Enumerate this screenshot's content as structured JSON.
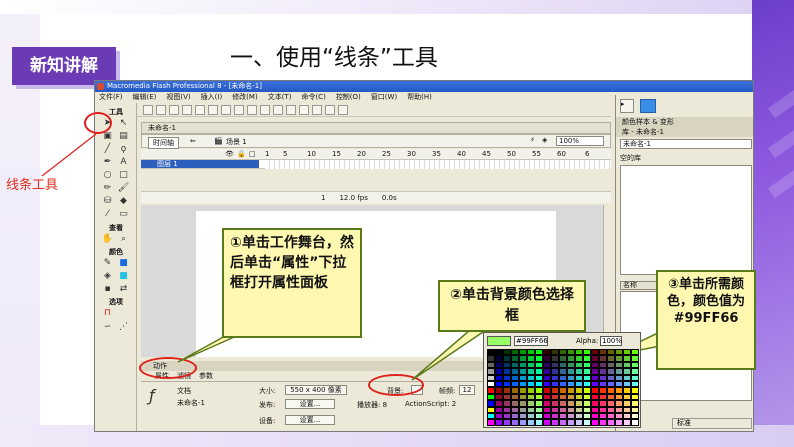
{
  "slide": {
    "badge": "新知讲解",
    "title": "一、使用“线条”工具",
    "side_label": "线条工具"
  },
  "window": {
    "title": "Macromedia Flash Professional 8 - [未命名-1]",
    "menus": [
      "文件(F)",
      "编辑(E)",
      "视图(V)",
      "插入(I)",
      "修改(M)",
      "文本(T)",
      "命令(C)",
      "控制(O)",
      "窗口(W)",
      "帮助(H)"
    ]
  },
  "toolbox": {
    "tools_label": "工具",
    "view_label": "查看",
    "colors_label": "颜色",
    "options_label": "选项"
  },
  "document": {
    "tab": "未命名-1",
    "timeline_button": "时间轴",
    "scene": "场景 1",
    "zoom": "100%",
    "layer": "图层 1",
    "frame_numbers": [
      "1",
      "5",
      "10",
      "15",
      "20",
      "25",
      "30",
      "35",
      "40",
      "45",
      "50",
      "55",
      "60",
      "6"
    ],
    "status": {
      "frame": "1",
      "fps": "12.0 fps",
      "time": "0.0s"
    }
  },
  "right_panel": {
    "top_tab": "颜色样本 & 变形",
    "library_tab": "库 - 未命名-1",
    "library_doc": "未命名-1",
    "library_empty": "空的库",
    "col_name": "名称",
    "col_type": "类型"
  },
  "properties": {
    "actions_header": "动作",
    "tabs": [
      "属性",
      "滤镜",
      "参数"
    ],
    "doc_label": "文档",
    "doc_name": "未命名-1",
    "size_label": "大小:",
    "size_value": "550 x 400 像素",
    "background_label": "背景:",
    "framerate_label": "帧频:",
    "framerate_value": "12",
    "publish_label": "发布:",
    "settings_button": "设置...",
    "player_label": "播放器: 8",
    "actionscript_label": "ActionScript: 2",
    "device_label": "设备:",
    "device_button": "设置..."
  },
  "callouts": {
    "c1": "①单击工作舞台，然后单击“属性”下拉框打开属性面板",
    "c2": "②单击背景颜色选择框",
    "c3": "③单击所需颜色，颜色值为#99FF66"
  },
  "color_picker": {
    "hex": "#99FF66",
    "alpha_label": "Alpha:",
    "alpha_value": "100%"
  },
  "bottom_right": "标准"
}
